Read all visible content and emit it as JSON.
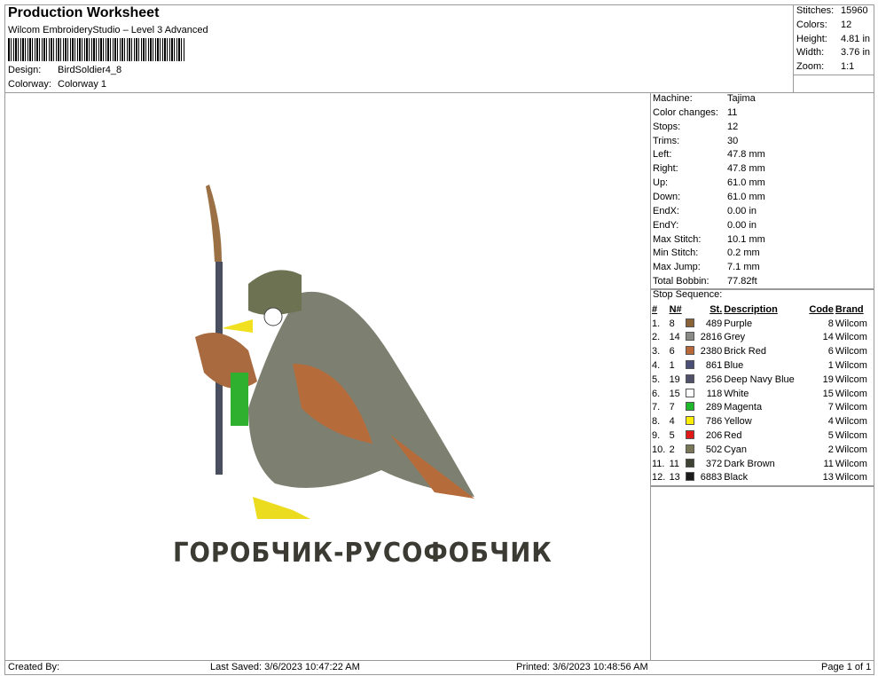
{
  "header": {
    "title": "Production Worksheet",
    "subtitle": "Wilcom EmbroideryStudio – Level 3 Advanced",
    "design_label": "Design:",
    "design": "BirdSoldier4_8",
    "colorway_label": "Colorway:",
    "colorway": "Colorway 1"
  },
  "summary": [
    {
      "k": "Stitches:",
      "v": "15960"
    },
    {
      "k": "Colors:",
      "v": "12"
    },
    {
      "k": "Height:",
      "v": "4.81 in"
    },
    {
      "k": "Width:",
      "v": "3.76 in"
    },
    {
      "k": "Zoom:",
      "v": "1:1"
    }
  ],
  "info": [
    {
      "k": "Machine:",
      "v": "Tajima"
    },
    {
      "k": "Color changes:",
      "v": "11"
    },
    {
      "k": "Stops:",
      "v": "12"
    },
    {
      "k": "Trims:",
      "v": "30"
    },
    {
      "k": "Left:",
      "v": "47.8 mm"
    },
    {
      "k": "Right:",
      "v": "47.8 mm"
    },
    {
      "k": "Up:",
      "v": "61.0 mm"
    },
    {
      "k": "Down:",
      "v": "61.0 mm"
    },
    {
      "k": "EndX:",
      "v": "0.00 in"
    },
    {
      "k": "EndY:",
      "v": "0.00 in"
    },
    {
      "k": "Max Stitch:",
      "v": "10.1 mm"
    },
    {
      "k": "Min Stitch:",
      "v": "0.2 mm"
    },
    {
      "k": "Max Jump:",
      "v": "7.1 mm"
    },
    {
      "k": "Total Bobbin:",
      "v": "77.82ft"
    }
  ],
  "stop_sequence": {
    "label": "Stop Sequence:",
    "headers": [
      "#",
      "N#",
      "St.",
      "Description",
      "Code",
      "Brand"
    ],
    "rows": [
      {
        "i": "1.",
        "n": "8",
        "color": "#8a6238",
        "st": "489",
        "desc": "Purple",
        "code": "8",
        "brand": "Wilcom"
      },
      {
        "i": "2.",
        "n": "14",
        "color": "#8a8a86",
        "st": "2816",
        "desc": "Grey",
        "code": "14",
        "brand": "Wilcom"
      },
      {
        "i": "3.",
        "n": "6",
        "color": "#b9683a",
        "st": "2380",
        "desc": "Brick Red",
        "code": "6",
        "brand": "Wilcom"
      },
      {
        "i": "4.",
        "n": "1",
        "color": "#4a4f78",
        "st": "861",
        "desc": "Blue",
        "code": "1",
        "brand": "Wilcom"
      },
      {
        "i": "5.",
        "n": "19",
        "color": "#50506a",
        "st": "256",
        "desc": "Deep Navy Blue",
        "code": "19",
        "brand": "Wilcom"
      },
      {
        "i": "6.",
        "n": "15",
        "color": "#ffffff",
        "st": "118",
        "desc": "White",
        "code": "15",
        "brand": "Wilcom"
      },
      {
        "i": "7.",
        "n": "7",
        "color": "#1fb82c",
        "st": "289",
        "desc": "Magenta",
        "code": "7",
        "brand": "Wilcom"
      },
      {
        "i": "8.",
        "n": "4",
        "color": "#ffee00",
        "st": "786",
        "desc": "Yellow",
        "code": "4",
        "brand": "Wilcom"
      },
      {
        "i": "9.",
        "n": "5",
        "color": "#e01818",
        "st": "206",
        "desc": "Red",
        "code": "5",
        "brand": "Wilcom"
      },
      {
        "i": "10.",
        "n": "2",
        "color": "#7a7658",
        "st": "502",
        "desc": "Cyan",
        "code": "2",
        "brand": "Wilcom"
      },
      {
        "i": "11.",
        "n": "11",
        "color": "#3e4232",
        "st": "372",
        "desc": "Dark Brown",
        "code": "11",
        "brand": "Wilcom"
      },
      {
        "i": "12.",
        "n": "13",
        "color": "#1a1a1a",
        "st": "6883",
        "desc": "Black",
        "code": "13",
        "brand": "Wilcom"
      }
    ]
  },
  "design_text": "ГОРОБЧИК-РУСОФОБЧИК",
  "footer": {
    "created": "Created By:",
    "saved": "Last Saved: 3/6/2023 10:47:22 AM",
    "printed": "Printed: 3/6/2023 10:48:56 AM",
    "page": "Page 1 of 1"
  }
}
